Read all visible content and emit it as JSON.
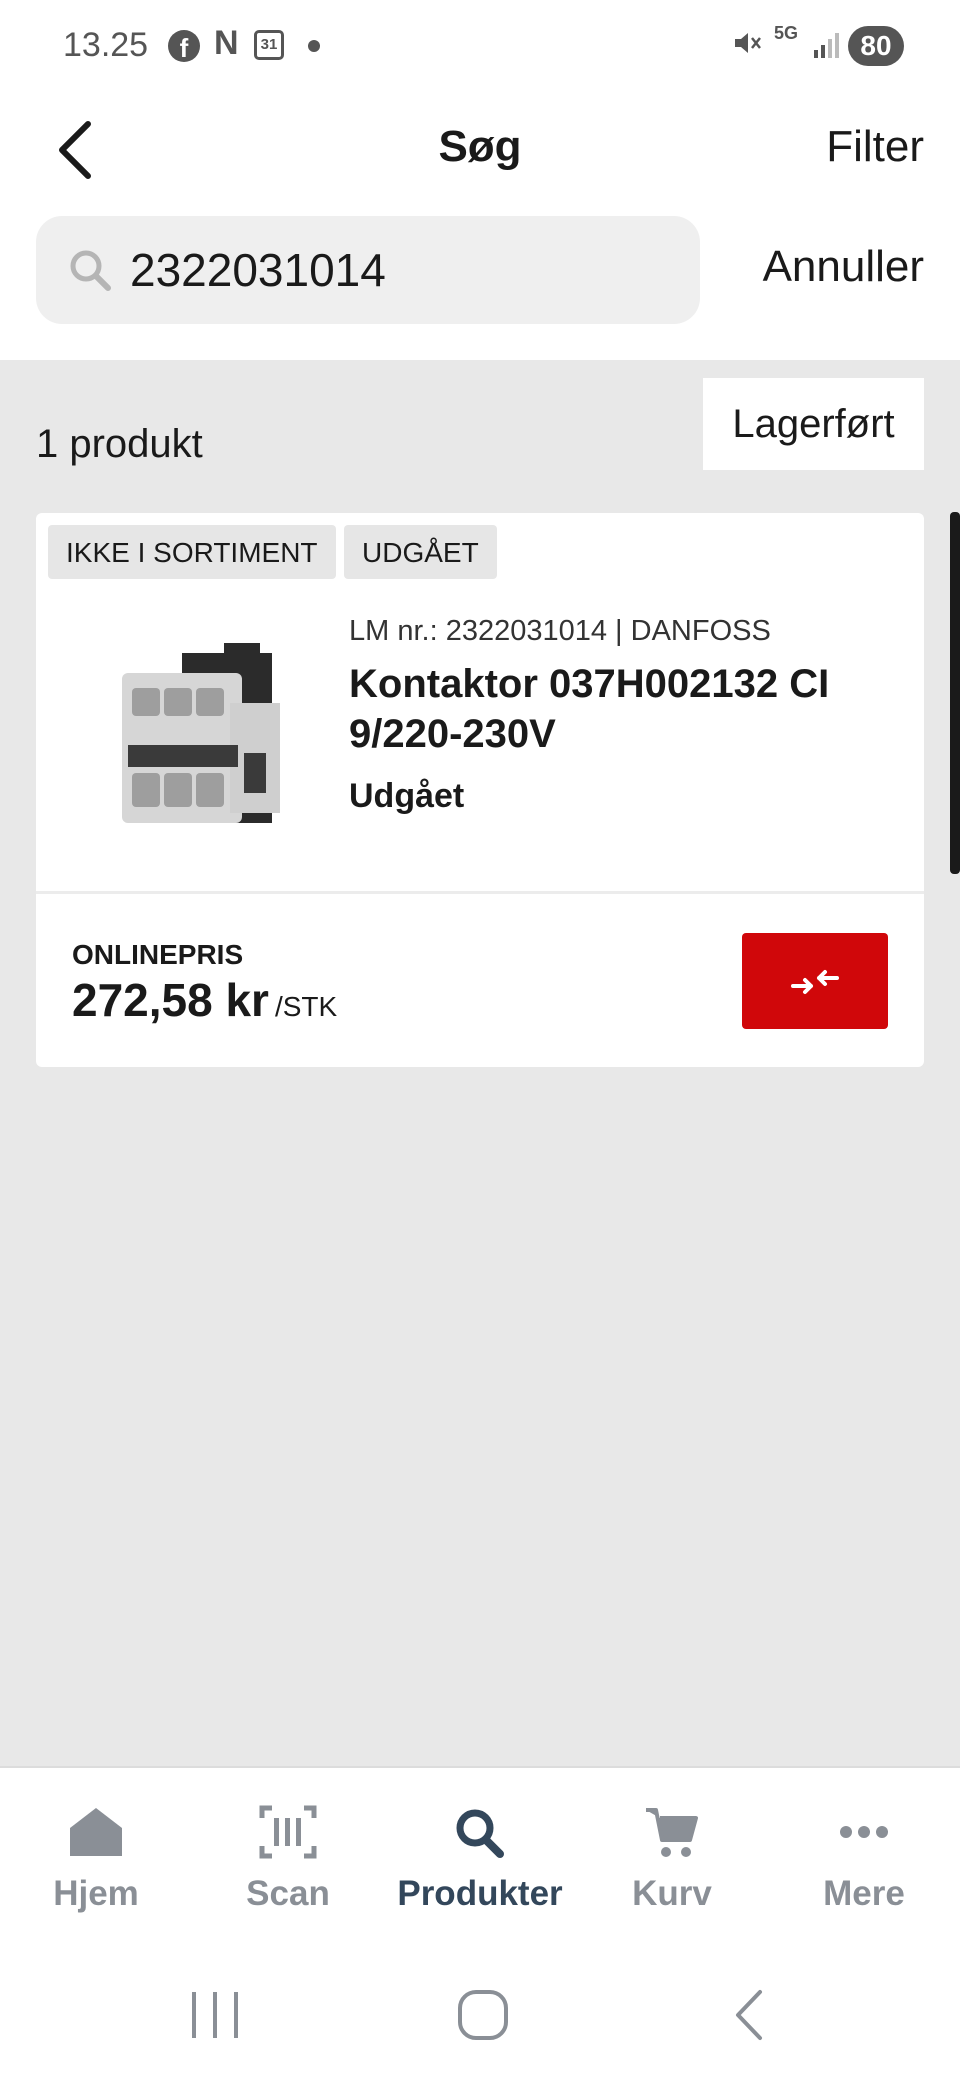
{
  "status_bar": {
    "time": "13.25",
    "battery": "80",
    "network": "5G",
    "calendar_day": "31",
    "notification_n": "N",
    "facebook_glyph": "f"
  },
  "header": {
    "title": "Søg",
    "filter_label": "Filter",
    "cancel_label": "Annuller"
  },
  "search": {
    "value": "2322031014",
    "placeholder": ""
  },
  "results": {
    "count_text": "1 produkt",
    "stock_filter_label": "Lagerført"
  },
  "product": {
    "badges": [
      "IKKE I SORTIMENT",
      "UDGÅET"
    ],
    "meta": "LM nr.: 2322031014  |  DANFOSS",
    "title": "Kontaktor 037H002132 CI 9/220-230V",
    "status": "Udgået",
    "price_label": "ONLINEPRIS",
    "price_value": "272,58 kr",
    "price_unit": "/STK"
  },
  "bottom_nav": {
    "items": [
      {
        "label": "Hjem",
        "icon": "home-icon"
      },
      {
        "label": "Scan",
        "icon": "barcode-icon"
      },
      {
        "label": "Produkter",
        "icon": "search-icon"
      },
      {
        "label": "Kurv",
        "icon": "cart-icon"
      },
      {
        "label": "Mere",
        "icon": "more-icon"
      }
    ],
    "active_index": 2
  },
  "colors": {
    "accent_red": "#d0070a",
    "nav_active": "#33475b",
    "nav_inactive": "#8a8f96",
    "background": "#e8e8e8"
  }
}
